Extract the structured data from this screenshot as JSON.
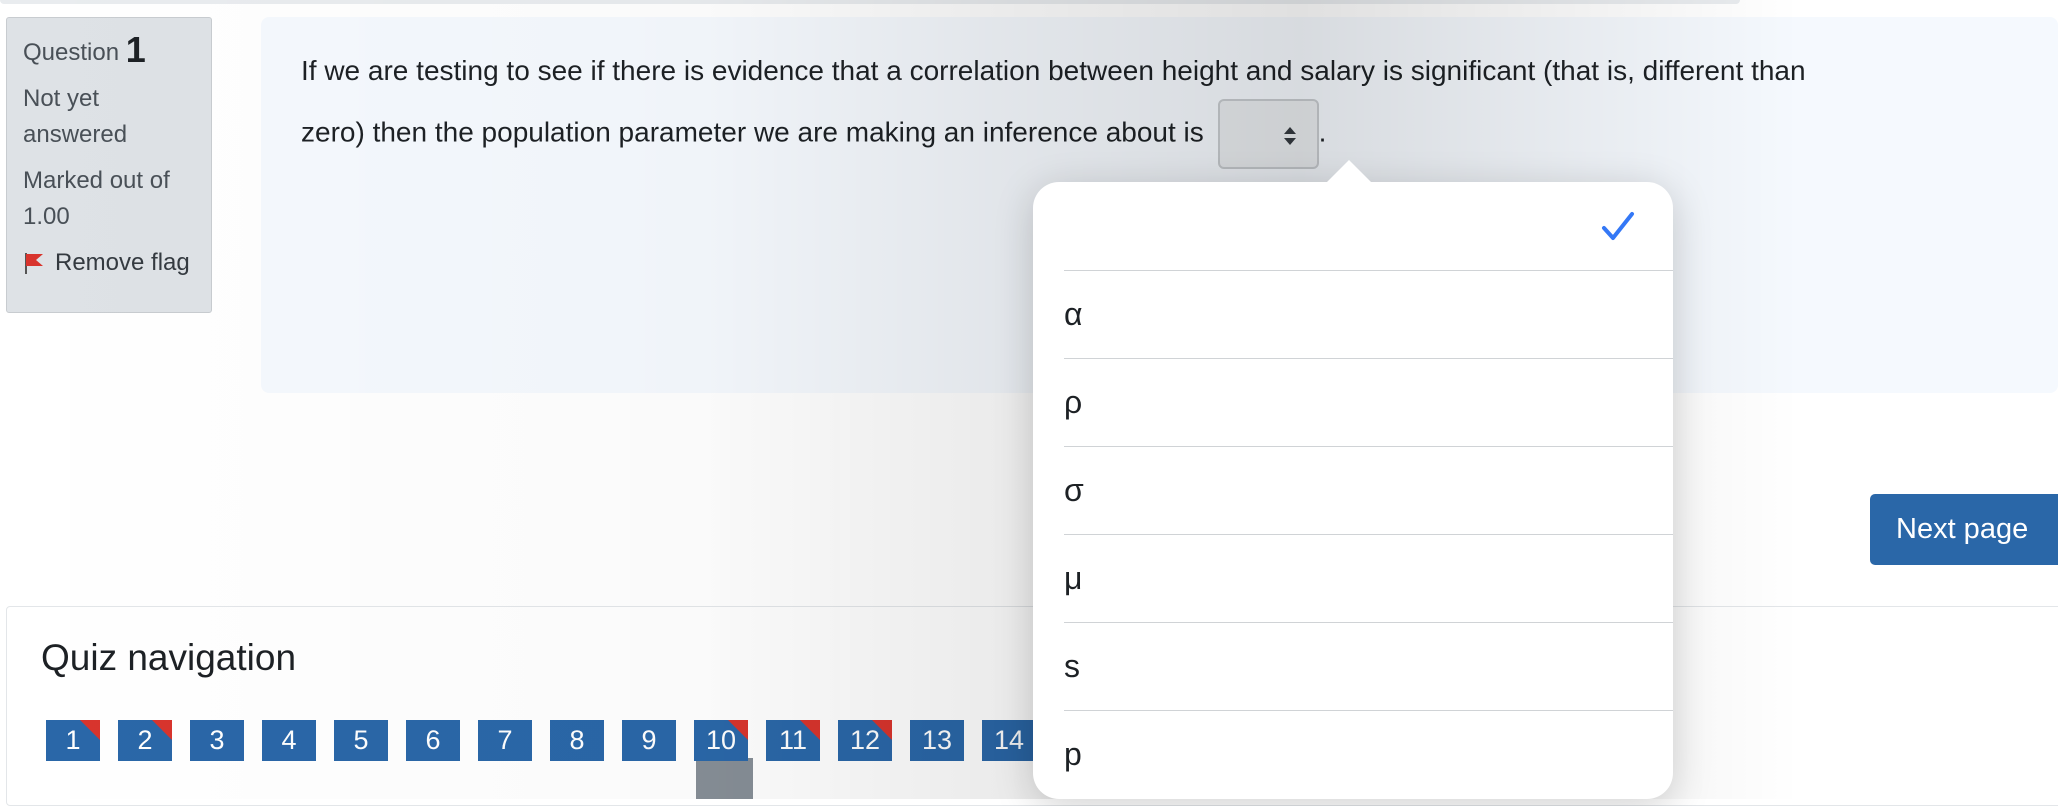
{
  "question_info": {
    "label": "Question",
    "number": "1",
    "state_line1": "Not yet",
    "state_line2": "answered",
    "mark_line1": "Marked out of",
    "mark_line2": "1.00",
    "flag_label": "Remove flag"
  },
  "question": {
    "text_line1": "If we are testing to see if there is evidence that a correlation between height and salary is significant (that is, different than",
    "text_line2": "zero) then the population parameter we are making an inference about is",
    "trailing": "."
  },
  "select": {
    "selected": "",
    "options": [
      "",
      "α",
      "ρ",
      "σ",
      "μ",
      "s",
      "p"
    ]
  },
  "next_button": "Next page",
  "quiz_nav": {
    "title": "Quiz navigation",
    "buttons": [
      {
        "label": "1",
        "flagged": true
      },
      {
        "label": "2",
        "flagged": true
      },
      {
        "label": "3",
        "flagged": false
      },
      {
        "label": "4",
        "flagged": false
      },
      {
        "label": "5",
        "flagged": false
      },
      {
        "label": "6",
        "flagged": false
      },
      {
        "label": "7",
        "flagged": false
      },
      {
        "label": "8",
        "flagged": false
      },
      {
        "label": "9",
        "flagged": false
      },
      {
        "label": "10",
        "flagged": true
      },
      {
        "label": "11",
        "flagged": true
      },
      {
        "label": "12",
        "flagged": true
      },
      {
        "label": "13",
        "flagged": false
      },
      {
        "label": "14",
        "flagged": false
      }
    ]
  },
  "colors": {
    "primary": "#2a67a8",
    "flag": "#d8342d",
    "check": "#3478f6"
  }
}
